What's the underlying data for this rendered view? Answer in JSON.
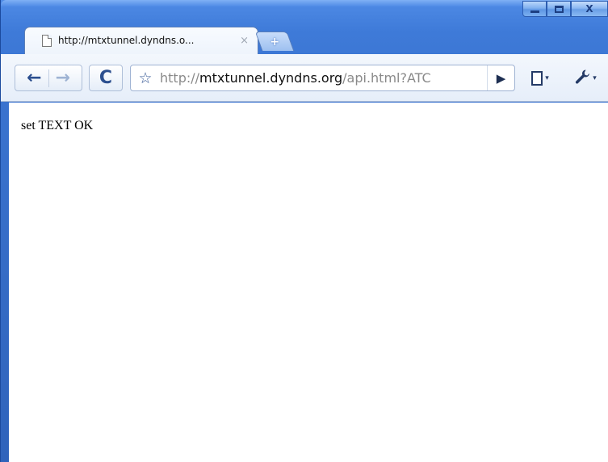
{
  "window": {
    "controls": {
      "minimize_icon": "minimize-icon",
      "maximize_icon": "maximize-icon",
      "close_label": "X"
    }
  },
  "tab": {
    "title": "http://mtxtunnel.dyndns.o...",
    "close_label": "×",
    "new_tab_label": "+"
  },
  "toolbar": {
    "back_label": "←",
    "forward_label": "→",
    "reload_label": "C",
    "star_label": "☆",
    "url_scheme": "http://",
    "url_host": "mtxtunnel.dyndns.org",
    "url_path": "/api.html?ATC",
    "go_label": "▶",
    "caret_label": "▾"
  },
  "page": {
    "body_text": "set TEXT OK"
  },
  "colors": {
    "frame": "#3e7ad8",
    "toolbar": "#e6eef9",
    "url_host": "#111111",
    "url_muted": "#8a8a8a"
  }
}
